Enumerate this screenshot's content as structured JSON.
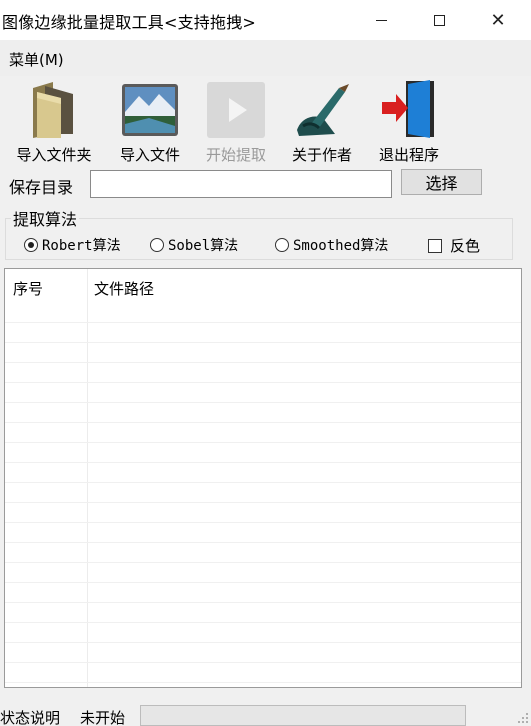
{
  "window": {
    "title": "图像边缘批量提取工具<支持拖拽>",
    "min_glyph": "",
    "close_glyph": "✕"
  },
  "menu": {
    "label": "菜单(M)"
  },
  "toolbar": {
    "items": [
      {
        "label": "导入文件夹",
        "icon": "folder-icon",
        "enabled": true
      },
      {
        "label": "导入文件",
        "icon": "image-file-icon",
        "enabled": true
      },
      {
        "label": "开始提取",
        "icon": "play-icon",
        "enabled": false
      },
      {
        "label": "关于作者",
        "icon": "pen-hand-icon",
        "enabled": true
      },
      {
        "label": "退出程序",
        "icon": "exit-door-icon",
        "enabled": true
      }
    ]
  },
  "save_dir": {
    "label": "保存目录",
    "value": "",
    "button_label": "选择"
  },
  "algorithm": {
    "group_title": "提取算法",
    "options": [
      {
        "label": "Robert算法",
        "checked": true
      },
      {
        "label": "Sobel算法",
        "checked": false
      },
      {
        "label": "Smoothed算法",
        "checked": false
      }
    ],
    "invert": {
      "label": "反色",
      "checked": false
    }
  },
  "file_list": {
    "columns": [
      "序号",
      "文件路径"
    ],
    "rows": []
  },
  "status": {
    "label": "状态说明",
    "value": "未开始",
    "progress": 0
  },
  "colors": {
    "window_bg": "#f0f0f0",
    "titlebar_bg": "#ffffff",
    "disabled_text": "#9a9a9a",
    "exit_door": "#1e7fd6",
    "exit_arrow": "#d91f1f"
  }
}
